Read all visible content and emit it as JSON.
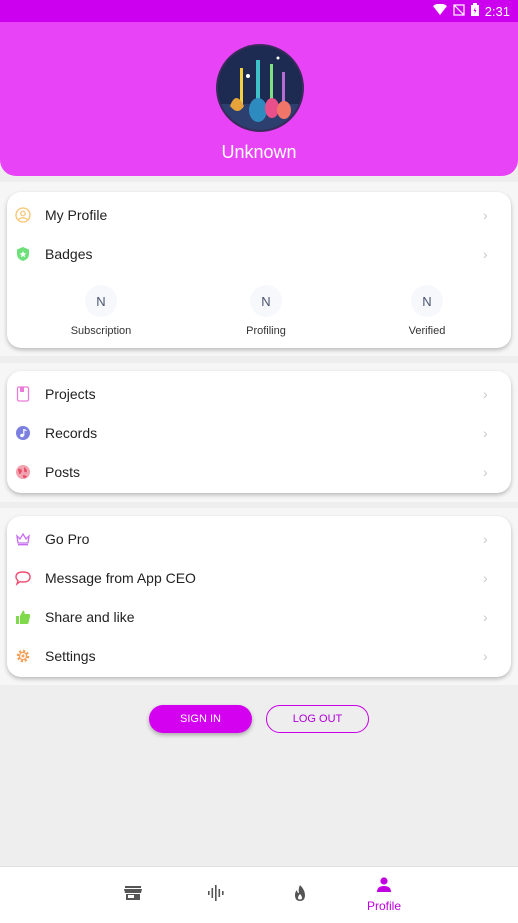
{
  "status_bar": {
    "time": "2:31"
  },
  "header": {
    "username": "Unknown"
  },
  "card1": {
    "items": [
      {
        "label": "My Profile",
        "icon": "user-circle-icon"
      },
      {
        "label": "Badges",
        "icon": "shield-icon"
      }
    ],
    "stats": [
      {
        "value": "N",
        "caption": "Subscription"
      },
      {
        "value": "N",
        "caption": "Profiling"
      },
      {
        "value": "N",
        "caption": "Verified"
      }
    ]
  },
  "card2": {
    "items": [
      {
        "label": "Projects",
        "icon": "projects-icon"
      },
      {
        "label": "Records",
        "icon": "music-note-icon"
      },
      {
        "label": "Posts",
        "icon": "globe-icon"
      }
    ]
  },
  "card3": {
    "items": [
      {
        "label": "Go Pro",
        "icon": "crown-icon"
      },
      {
        "label": "Message from App CEO",
        "icon": "chat-bubble-icon"
      },
      {
        "label": "Share and like",
        "icon": "thumbs-up-icon"
      },
      {
        "label": "Settings",
        "icon": "gear-icon"
      }
    ]
  },
  "buttons": {
    "sign_in": "SIGN IN",
    "log_out": "LOG OUT"
  },
  "bottom_nav": {
    "items": [
      {
        "icon": "store-icon",
        "label": ""
      },
      {
        "icon": "audio-wave-icon",
        "label": ""
      },
      {
        "icon": "fire-icon",
        "label": ""
      },
      {
        "icon": "person-icon",
        "label": "Profile",
        "active": true
      }
    ]
  },
  "colors": {
    "accent": "#e843f7",
    "status_bar": "#cc00ee",
    "button": "#d400f0"
  }
}
